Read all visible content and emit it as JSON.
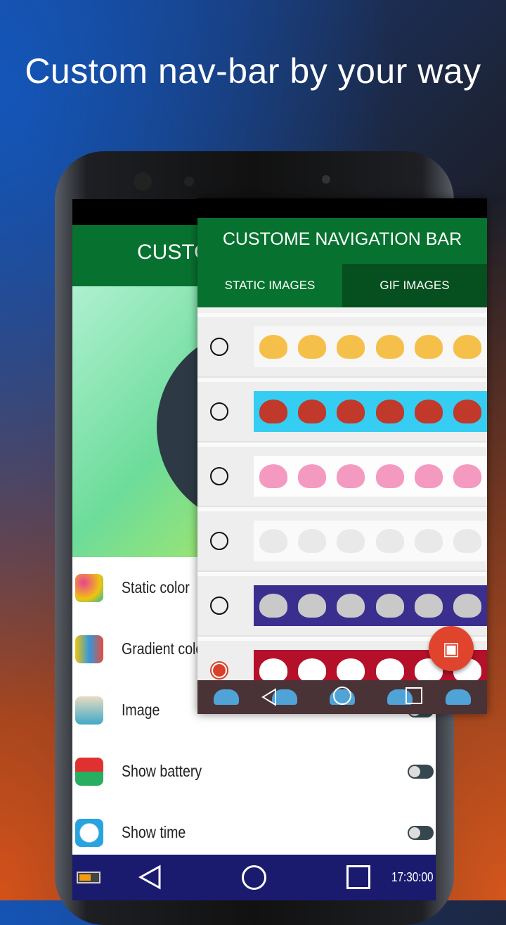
{
  "headline": "Custom nav-bar by your way",
  "back_screen": {
    "header_title": "CUSTOM",
    "items": [
      {
        "label": "Static color",
        "icon": "color-circles-icon",
        "toggle": false
      },
      {
        "label": "Gradient color",
        "icon": "color-palette-icon",
        "toggle": false
      },
      {
        "label": "Image",
        "icon": "image-icon",
        "toggle": true,
        "toggle_on": false
      },
      {
        "label": "Show battery",
        "icon": "battery-icon",
        "toggle": true,
        "toggle_on": false
      },
      {
        "label": "Show time",
        "icon": "stopwatch-icon",
        "toggle": true,
        "toggle_on": false
      }
    ],
    "nav": {
      "time": "17:30:00",
      "color": "#1a1a6e"
    }
  },
  "front_screen": {
    "title": "CUSTOME NAVIGATION BAR",
    "tabs": [
      {
        "label": "STATIC IMAGES",
        "selected": false
      },
      {
        "label": "GIF IMAGES",
        "selected": true
      }
    ],
    "items": [
      {
        "theme": "cats",
        "bg": "#f7f7f7",
        "blob": "#f5c04a",
        "selected": false
      },
      {
        "theme": "roosters",
        "bg": "#35cdf2",
        "blob": "#c0392b",
        "selected": false
      },
      {
        "theme": "bears-hearts",
        "bg": "#fdfdfd",
        "blob": "#f49ac1",
        "selected": false
      },
      {
        "theme": "bunnies-i-love-u",
        "bg": "#fafafa",
        "blob": "#e9e9e9",
        "selected": false
      },
      {
        "theme": "elephants",
        "bg": "#3a2f8f",
        "blob": "#c9c9c9",
        "selected": false
      },
      {
        "theme": "bears-red",
        "bg": "#b5102a",
        "blob": "#ffffff",
        "selected": true
      }
    ],
    "nav_color": "#4a3336",
    "fab_icon": "add-image-icon",
    "accent": "#07722f"
  }
}
